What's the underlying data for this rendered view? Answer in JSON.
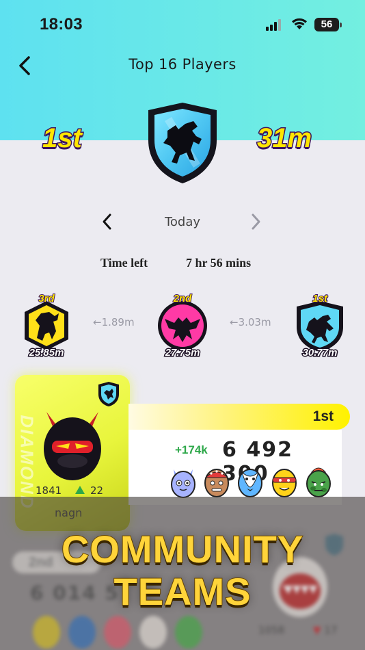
{
  "status_bar": {
    "time": "18:03",
    "battery": "56"
  },
  "header": {
    "title": "Top 16 Players"
  },
  "hero": {
    "rank": "1st",
    "distance": "31m",
    "league_icon": "griffin-shield-icon"
  },
  "day_nav": {
    "label": "Today"
  },
  "time_left": {
    "label": "Time left",
    "value": "7 hr 56 mins"
  },
  "leagues": [
    {
      "rank": "3rd",
      "distance": "25.85m",
      "icon": "unicorn-hex-icon",
      "color": "#ffe019"
    },
    {
      "gap": "1.89m"
    },
    {
      "rank": "2nd",
      "distance": "27.75m",
      "icon": "dragon-circle-icon",
      "color": "#ff3aa5"
    },
    {
      "gap": "3.03m"
    },
    {
      "rank": "1st",
      "distance": "30.77m",
      "icon": "griffin-shield-icon",
      "color": "#5fd8f5"
    }
  ],
  "player_card": {
    "tier_watermark": "DIAMOND",
    "trophies": "1841",
    "trophy_gain": "22",
    "name": "nagn",
    "rank": "1st",
    "delta": "+174k",
    "score": "6 492 300"
  },
  "team_eggs": [
    "blue-devil-egg-icon",
    "brown-tribal-egg-icon",
    "blue-tux-egg-icon",
    "yellow-bandana-egg-icon",
    "green-camo-egg-icon"
  ],
  "blurred_next": {
    "rank": "2nd",
    "score": "6 014 5",
    "trophies": "1058",
    "trophy_loss": "17"
  },
  "promo": {
    "line1": "COMMUNITY",
    "line2": "TEAMS"
  },
  "colors": {
    "accent_cyan": "#5ee1f0",
    "accent_yellow": "#ffe600",
    "positive": "#2ea84a"
  }
}
